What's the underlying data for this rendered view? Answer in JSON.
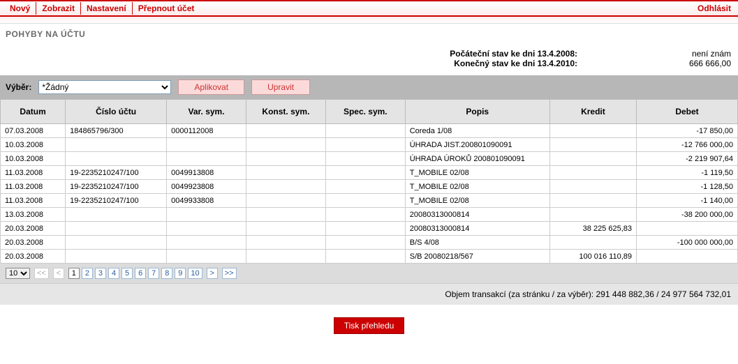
{
  "menu": {
    "novy": "Nový",
    "zobrazit": "Zobrazit",
    "nastaveni": "Nastavení",
    "prepnout": "Přepnout účet",
    "odhlasit": "Odhlásit"
  },
  "page_title": "POHYBY NA ÚČTU",
  "summary": {
    "start_label": "Počáteční stav ke dni 13.4.2008:",
    "start_value": "není znám",
    "end_label": "Konečný stav ke dni 13.4.2010:",
    "end_value": "666 666,00"
  },
  "filter": {
    "label": "Výběr:",
    "selected": "*Žádný",
    "apply": "Aplikovat",
    "edit": "Upravit"
  },
  "columns": {
    "datum": "Datum",
    "ucet": "Číslo účtu",
    "var": "Var. sym.",
    "konst": "Konst. sym.",
    "spec": "Spec. sym.",
    "popis": "Popis",
    "kredit": "Kredit",
    "debet": "Debet"
  },
  "rows": [
    {
      "datum": "07.03.2008",
      "ucet": "184865796/300",
      "var": "0000112008",
      "ks": "",
      "ss": "",
      "popis": "Coreda 1/08",
      "kredit": "",
      "debet": "-17 850,00"
    },
    {
      "datum": "10.03.2008",
      "ucet": "",
      "var": "",
      "ks": "",
      "ss": "",
      "popis": "ÚHRADA JIST.200801090091",
      "kredit": "",
      "debet": "-12 766 000,00"
    },
    {
      "datum": "10.03.2008",
      "ucet": "",
      "var": "",
      "ks": "",
      "ss": "",
      "popis": "ÚHRADA ÚROKŮ 200801090091",
      "kredit": "",
      "debet": "-2 219 907,64"
    },
    {
      "datum": "11.03.2008",
      "ucet": "19-2235210247/100",
      "var": "0049913808",
      "ks": "",
      "ss": "",
      "popis": "T_MOBILE 02/08",
      "kredit": "",
      "debet": "-1 119,50"
    },
    {
      "datum": "11.03.2008",
      "ucet": "19-2235210247/100",
      "var": "0049923808",
      "ks": "",
      "ss": "",
      "popis": "T_MOBILE 02/08",
      "kredit": "",
      "debet": "-1 128,50"
    },
    {
      "datum": "11.03.2008",
      "ucet": "19-2235210247/100",
      "var": "0049933808",
      "ks": "",
      "ss": "",
      "popis": "T_MOBILE 02/08",
      "kredit": "",
      "debet": "-1 140,00"
    },
    {
      "datum": "13.03.2008",
      "ucet": "",
      "var": "",
      "ks": "",
      "ss": "",
      "popis": "20080313000814",
      "kredit": "",
      "debet": "-38 200 000,00"
    },
    {
      "datum": "20.03.2008",
      "ucet": "",
      "var": "",
      "ks": "",
      "ss": "",
      "popis": "20080313000814",
      "kredit": "38 225 625,83",
      "debet": ""
    },
    {
      "datum": "20.03.2008",
      "ucet": "",
      "var": "",
      "ks": "",
      "ss": "",
      "popis": "B/S 4/08",
      "kredit": "",
      "debet": "-100 000 000,00"
    },
    {
      "datum": "20.03.2008",
      "ucet": "",
      "var": "",
      "ks": "",
      "ss": "",
      "popis": "S/B 20080218/567",
      "kredit": "100 016 110,89",
      "debet": ""
    }
  ],
  "pager": {
    "size": "10",
    "first": "<<",
    "prev": "<",
    "next": ">",
    "last": ">>",
    "pages": [
      "1",
      "2",
      "3",
      "4",
      "5",
      "6",
      "7",
      "8",
      "9",
      "10"
    ]
  },
  "footer": {
    "label": "Objem transakcí (za stránku / za výběr): ",
    "value": "291 448 882,36 / 24 977 564 732,01"
  },
  "print_label": "Tisk přehledu"
}
